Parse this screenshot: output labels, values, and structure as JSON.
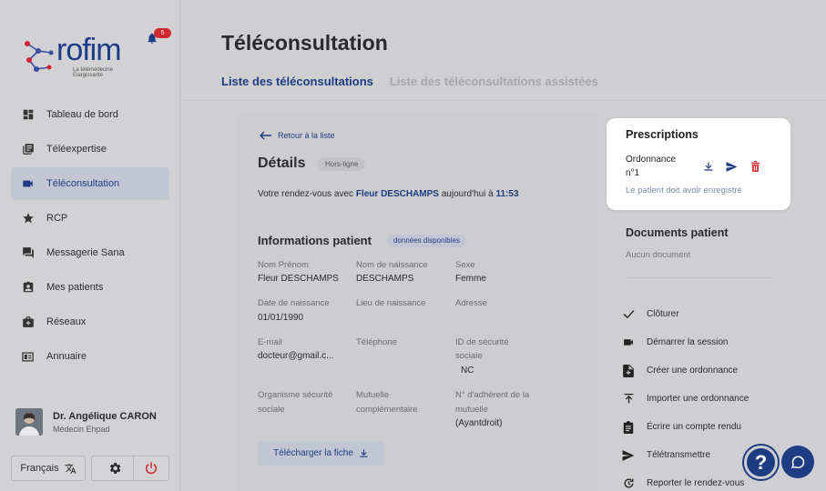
{
  "brand": {
    "logo_text": "rofim",
    "logo_sub": "La télémédecine Élargissante"
  },
  "notifications": {
    "count": "5"
  },
  "sidebar": {
    "items": [
      {
        "label": "Tableau de bord",
        "icon": "dashboard-icon"
      },
      {
        "label": "Téléexpertise",
        "icon": "library-icon"
      },
      {
        "label": "Téléconsultation",
        "icon": "videocam-icon",
        "active": true
      },
      {
        "label": "RCP",
        "icon": "star-icon"
      },
      {
        "label": "Messagerie Sana",
        "icon": "chat-icon"
      },
      {
        "label": "Mes patients",
        "icon": "patient-badge-icon"
      },
      {
        "label": "Réseaux",
        "icon": "medical-bag-icon"
      },
      {
        "label": "Annuaire",
        "icon": "contact-card-icon"
      }
    ],
    "user": {
      "name": "Dr. Angélique CARON",
      "role": "Médecin Ehpad"
    },
    "language": "Français"
  },
  "header": {
    "title": "Téléconsultation",
    "tabs": [
      {
        "label": "Liste des téléconsultations",
        "active": true
      },
      {
        "label": "Liste des téléconsultations assistées",
        "active": false
      }
    ]
  },
  "details": {
    "back_label": "Retour à la liste",
    "title": "Détails",
    "status_badge": "Hors-ligne",
    "rdv_prefix": "Votre rendez-vous avec ",
    "rdv_patient": "Fleur DESCHAMPS",
    "rdv_middle": " aujourd'hui à ",
    "rdv_time": "11:53"
  },
  "patient": {
    "title": "Informations patient",
    "badge": "données disponibles",
    "fields": {
      "nom_prenom": {
        "label": "Nom Prénom",
        "value": "Fleur DESCHAMPS"
      },
      "nom_naissance": {
        "label": "Nom de naissance",
        "value": "DESCHAMPS"
      },
      "sexe": {
        "label": "Sexe",
        "value": "Femme"
      },
      "date_naissance": {
        "label": "Date de naissance",
        "value": "01/01/1990"
      },
      "lieu_naissance": {
        "label": "Lieu de naissance",
        "value": ""
      },
      "adresse": {
        "label": "Adresse",
        "value": ""
      },
      "email": {
        "label": "E-mail",
        "value": "docteur@gmail.c..."
      },
      "telephone": {
        "label": "Téléphone",
        "value": ""
      },
      "secu_id": {
        "label_line1": "ID de sécurité",
        "label_line2": "sociale",
        "value": "NC"
      },
      "organisme": {
        "label_line1": "Organisme sécurité",
        "label_line2": "sociale",
        "value": ""
      },
      "mutuelle": {
        "label_line1": "Mutuelle",
        "label_line2": "complémentaire",
        "value": ""
      },
      "adherent": {
        "label_line1": "N° d'adhérent de la",
        "label_line2": "mutuelle",
        "value": "(Ayantdroit)"
      }
    },
    "download_label": "Télécharger la fiche"
  },
  "prescriptions": {
    "title": "Prescriptions",
    "doc_line1": "Ordonnance",
    "doc_line2": "n°1",
    "note": "Le patient doit avoir enregistré"
  },
  "documents": {
    "title": "Documents patient",
    "empty": "Aucun document"
  },
  "actions": [
    {
      "label": "Clôturer",
      "icon": "check-icon"
    },
    {
      "label": "Démarrer la session",
      "icon": "videocam-icon"
    },
    {
      "label": "Créer une ordonnance",
      "icon": "add-document-icon"
    },
    {
      "label": "Importer une ordonnance",
      "icon": "upload-icon"
    },
    {
      "label": "Écrire un compte rendu",
      "icon": "clipboard-icon"
    },
    {
      "label": "Télétransmettre",
      "icon": "send-icon"
    },
    {
      "label": "Reporter le rendez-vous",
      "icon": "reschedule-icon"
    }
  ],
  "colors": {
    "accent": "#1e3c82",
    "danger": "#d0282e",
    "page_bg": "#cfcfd2"
  },
  "help_symbol": "?"
}
